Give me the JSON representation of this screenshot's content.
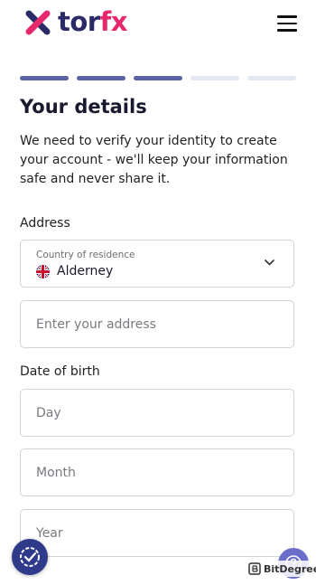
{
  "brand": {
    "logo_prefix": "tor",
    "logo_suffix": "fx",
    "colors": {
      "navy": "#2a2a66",
      "pink": "#e6286e",
      "progress": "#5a63a8"
    }
  },
  "header": {
    "menu_icon": "hamburger-menu-icon"
  },
  "progress": {
    "total_steps": 5,
    "completed_steps": 3
  },
  "page": {
    "title": "Your details",
    "intro": "We need to verify your identity to create your account - we'll keep your information safe and never share it."
  },
  "address": {
    "section_label": "Address",
    "country_label": "Country of residence",
    "country_value": "Alderney",
    "country_flag": "uk-flag-icon",
    "address_placeholder": "Enter your address"
  },
  "dob": {
    "section_label": "Date of birth",
    "day_placeholder": "Day",
    "month_placeholder": "Month",
    "year_placeholder": "Year"
  },
  "widgets": {
    "cookie_icon": "cookie-settings-icon",
    "help_icon": "help-icon",
    "watermark": "BitDegree"
  }
}
